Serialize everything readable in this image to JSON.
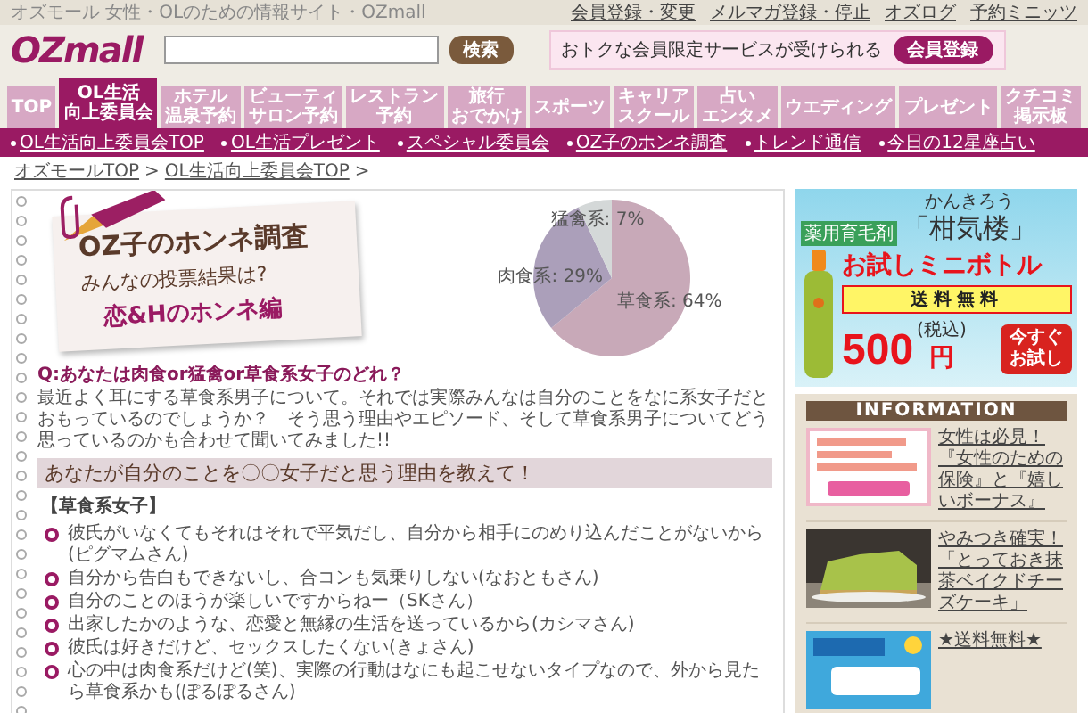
{
  "top_bar": {
    "tagline": "オズモール 女性・OLのための情報サイト・OZmall",
    "links": [
      "会員登録・変更",
      "メルマガ登録・停止",
      "オズログ",
      "予約ミニッツ"
    ]
  },
  "header": {
    "logo": "OZmall",
    "search_button": "検索",
    "promo_text": "おトクな会員限定サービスが受けられる",
    "register_button": "会員登録"
  },
  "nav_tabs": [
    {
      "lines": [
        "TOP"
      ],
      "selected": false
    },
    {
      "lines": [
        "OL生活",
        "向上委員会"
      ],
      "selected": true
    },
    {
      "lines": [
        "ホテル",
        "温泉予約"
      ],
      "selected": false
    },
    {
      "lines": [
        "ビューティ",
        "サロン予約"
      ],
      "selected": false
    },
    {
      "lines": [
        "レストラン",
        "予約"
      ],
      "selected": false
    },
    {
      "lines": [
        "旅行",
        "おでかけ"
      ],
      "selected": false
    },
    {
      "lines": [
        "スポーツ"
      ],
      "selected": false
    },
    {
      "lines": [
        "キャリア",
        "スクール"
      ],
      "selected": false
    },
    {
      "lines": [
        "占い",
        "エンタメ"
      ],
      "selected": false
    },
    {
      "lines": [
        "ウエディング"
      ],
      "selected": false
    },
    {
      "lines": [
        "プレゼント"
      ],
      "selected": false
    },
    {
      "lines": [
        "クチコミ",
        "掲示板"
      ],
      "selected": false
    }
  ],
  "sub_nav": [
    "OL生活向上委員会TOP",
    "OL生活プレゼント",
    "スペシャル委員会",
    "OZ子のホンネ調査",
    "トレンド通信",
    "今日の12星座占い"
  ],
  "breadcrumb": {
    "items": [
      "オズモールTOP",
      "OL生活向上委員会TOP"
    ],
    "separator": ">"
  },
  "article": {
    "title_card": [
      "OZ子のホンネ調査",
      "みんなの投票結果は?",
      "恋&Hのホンネ編"
    ],
    "chart_data": {
      "type": "pie",
      "values": [
        64,
        29,
        7
      ],
      "value_labels": [
        "草食系: 64%",
        "肉食系: 29%",
        "猛禽系: 7%"
      ]
    },
    "question": "Q:あなたは肉食or猛禽or草食系女子のどれ？",
    "intro": "最近よく耳にする草食系男子について。それでは実際みんなは自分のことをなに系女子だとおもっているのでしょうか？　そう思う理由やエピソード、そして草食系男子についてどう思っているのかも合わせて聞いてみました!!",
    "section_heading": "あなたが自分のことを〇〇女子だと思う理由を教えて！",
    "group_label": "【草食系女子】",
    "answers": [
      "彼氏がいなくてもそれはそれで平気だし、自分から相手にのめり込んだことがないから(ピグマムさん)",
      "自分から告白もできないし、合コンも気乗りしない(なおともさん)",
      "自分のことのほうが楽しいですからねー（SKさん）",
      "出家したかのような、恋愛と無縁の生活を送っているから(カシマさん)",
      "彼氏は好きだけど、セックスしたくない(きょさん)",
      "心の中は肉食系だけど(笑)、実際の行動はなにも起こせないタイプなので、外から見たら草食系かも(ぽるぽるさん)"
    ]
  },
  "sidebar": {
    "ad": {
      "category": "薬用育毛剤",
      "reading": "かんきろう",
      "brand": "「柑気楼」",
      "headline": "お試しミニボトル",
      "shipping": "送料無料",
      "price": "500",
      "currency": "円",
      "tax_note": "(税込)",
      "cta_button": "今すぐお試し"
    },
    "information": {
      "title": "INFORMATION",
      "items": [
        "女性は必見！『女性のための保険』と『嬉しいボーナス』",
        "やみつき確実！「とっておき抹茶ベイクドチーズケーキ」",
        "★送料無料★"
      ]
    }
  }
}
